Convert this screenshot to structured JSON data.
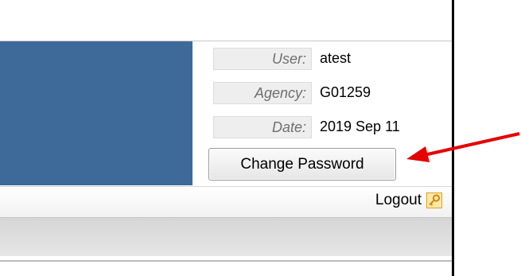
{
  "header": {
    "user_label": "User:",
    "user_value": "atest",
    "agency_label": "Agency:",
    "agency_value": "G01259",
    "date_label": "Date:",
    "date_value": "2019 Sep 11",
    "change_password_label": "Change Password"
  },
  "nav": {
    "logout_label": "Logout",
    "logout_icon": "key-icon"
  },
  "colors": {
    "banner": "#3d6a99",
    "annotation_arrow": "#e60000",
    "icon_accent": "#f0a020"
  }
}
